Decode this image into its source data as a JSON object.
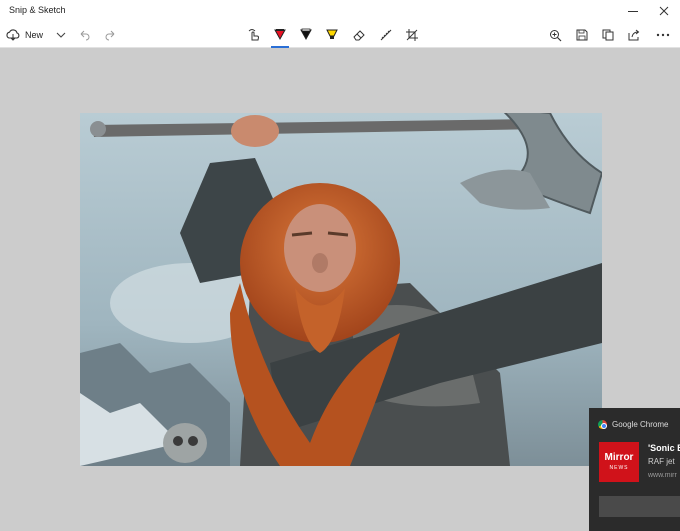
{
  "window": {
    "title": "Snip & Sketch",
    "controls": [
      "minimize-icon",
      "maximize-icon",
      "close-icon"
    ]
  },
  "toolbar": {
    "new_label": "New",
    "left_icons": [
      "new-snip-icon",
      "chevron-down-icon",
      "undo-icon",
      "redo-icon"
    ],
    "tools": [
      "touch-writing-icon",
      "ballpoint-pen-icon",
      "pencil-icon",
      "highlighter-icon",
      "eraser-icon",
      "ruler-icon",
      "crop-icon"
    ],
    "active_tool": "ballpoint-pen-icon",
    "right_icons": [
      "zoom-icon",
      "save-icon",
      "copy-icon",
      "share-icon",
      "more-icon"
    ],
    "pen_colors": {
      "ballpoint": "#e81123",
      "pencil": "#111111",
      "highlighter": "#ffd800"
    },
    "accent": "#2a6fd6"
  },
  "notification": {
    "app_name": "Google Chrome",
    "logo_text": "Mirror",
    "logo_subtext": "NEWS",
    "logo_color": "#d0121a",
    "title": "'Sonic B",
    "body": "RAF jet",
    "source": "www.mirr"
  }
}
